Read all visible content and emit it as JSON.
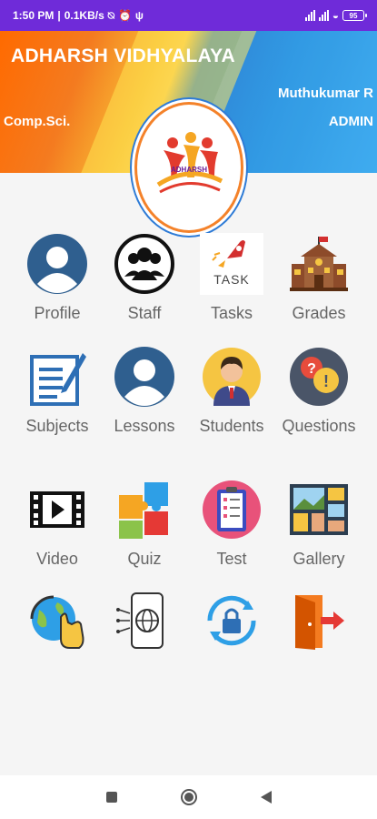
{
  "status_bar": {
    "time": "1:50 PM",
    "speed": "0.1KB/s",
    "battery": "95"
  },
  "banner": {
    "school_name": "ADHARSH VIDHYALAYA",
    "user_name": "Muthukumar R",
    "department": "Comp.Sci.",
    "role": "ADMIN",
    "logo_text": "ADHARSH"
  },
  "menu": [
    {
      "label": "Profile",
      "icon": "profile-icon"
    },
    {
      "label": "Staff",
      "icon": "staff-icon"
    },
    {
      "label": "Tasks",
      "icon": "tasks-icon"
    },
    {
      "label": "Grades",
      "icon": "school-building-icon"
    },
    {
      "label": "Subjects",
      "icon": "notebook-pen-icon"
    },
    {
      "label": "Lessons",
      "icon": "lessons-user-icon"
    },
    {
      "label": "Students",
      "icon": "student-icon"
    },
    {
      "label": "Questions",
      "icon": "questions-icon"
    },
    {
      "label": "Video",
      "icon": "video-icon"
    },
    {
      "label": "Quiz",
      "icon": "puzzle-icon"
    },
    {
      "label": "Test",
      "icon": "clipboard-test-icon"
    },
    {
      "label": "Gallery",
      "icon": "gallery-icon"
    },
    {
      "label": "",
      "icon": "globe-touch-icon"
    },
    {
      "label": "",
      "icon": "phone-globe-icon"
    },
    {
      "label": "",
      "icon": "lock-refresh-icon"
    },
    {
      "label": "",
      "icon": "logout-door-icon"
    }
  ],
  "colors": {
    "status_bar": "#6f2bd9",
    "label_text": "#666666",
    "banner_orange": "#f47b20",
    "banner_blue": "#1a8ee0"
  }
}
